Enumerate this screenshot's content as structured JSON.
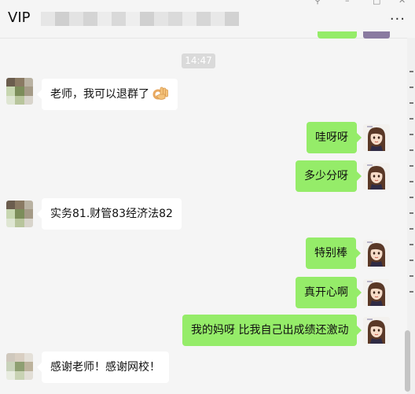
{
  "window": {
    "title": "VIP",
    "more_label": "···",
    "controls": [
      "⚲",
      "–",
      "□",
      "✕"
    ]
  },
  "colors": {
    "background": "#f5f5f5",
    "sent_bubble": "#95ec69",
    "received_bubble": "#ffffff",
    "time_badge": "#dadada"
  },
  "chat": {
    "timestamp": "14:47",
    "messages": [
      {
        "side": "left",
        "text": "老师，我可以退群了",
        "emoji": "ok-hand-icon"
      },
      {
        "side": "right",
        "text": "哇呀呀"
      },
      {
        "side": "right",
        "text": "多少分呀"
      },
      {
        "side": "left",
        "text": "实务81.财管83经济法82"
      },
      {
        "side": "right",
        "text": "特别棒"
      },
      {
        "side": "right",
        "text": "真开心啊"
      },
      {
        "side": "right",
        "text": "我的妈呀 比我自己出成绩还激动"
      },
      {
        "side": "left",
        "text": "感谢老师！感谢网校！"
      }
    ]
  }
}
